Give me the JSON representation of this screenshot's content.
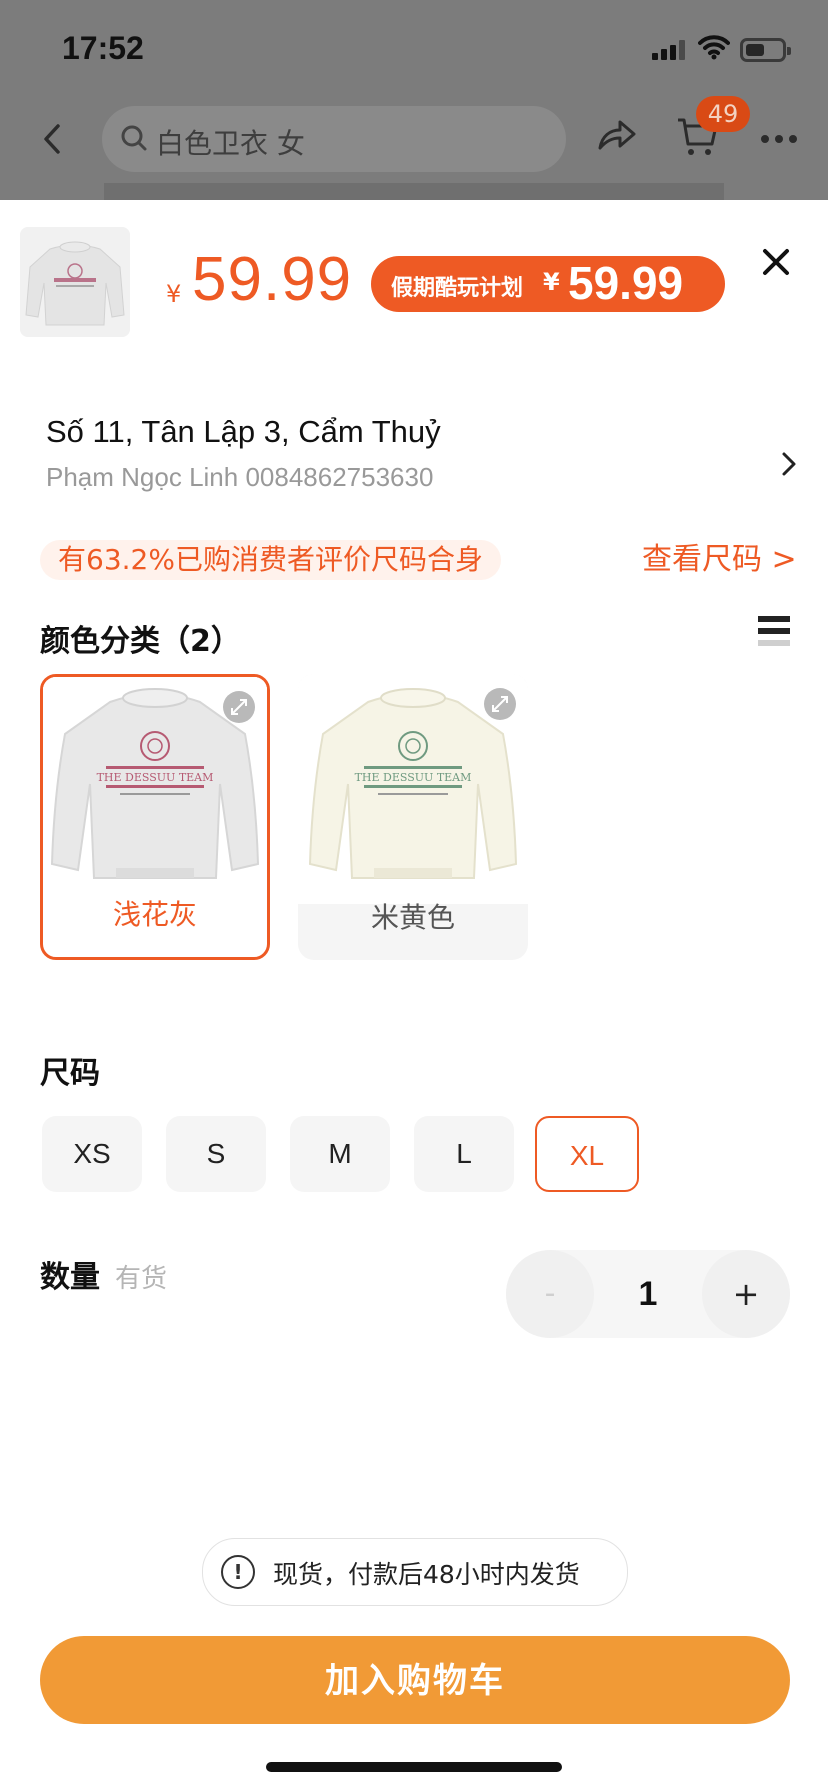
{
  "status_bar": {
    "time": "17:52"
  },
  "nav": {
    "search_text": "白色卫衣 女",
    "cart_count": "49"
  },
  "product": {
    "currency": "¥",
    "price": "59.99",
    "promo_label": "假期酷玩计划",
    "promo_currency": "¥",
    "promo_price": "59.99"
  },
  "address": {
    "line": "Số 11, Tân Lập 3, Cẩm Thuỷ",
    "person": "Phạm Ngọc Linh 0084862753630"
  },
  "fit": {
    "text": "有63.2%已购消费者评价尺码合身",
    "size_guide": "查看尺码 >"
  },
  "colors": {
    "title": "颜色分类（2）",
    "options": [
      {
        "label": "浅花灰",
        "selected": true
      },
      {
        "label": "米黄色",
        "selected": false
      }
    ],
    "sweater_text": "THE DESSUU TEAM"
  },
  "sizes": {
    "title": "尺码",
    "options": [
      "XS",
      "S",
      "M",
      "L",
      "XL"
    ],
    "selected": "XL"
  },
  "quantity": {
    "title": "数量",
    "stock": "有货",
    "minus": "-",
    "value": "1",
    "plus": "+"
  },
  "shipping_note": "现货，付款后48小时内发货",
  "add_to_cart": "加入购物车",
  "colors_theme": {
    "accent": "#ee5a24",
    "button": "#f19a36"
  }
}
